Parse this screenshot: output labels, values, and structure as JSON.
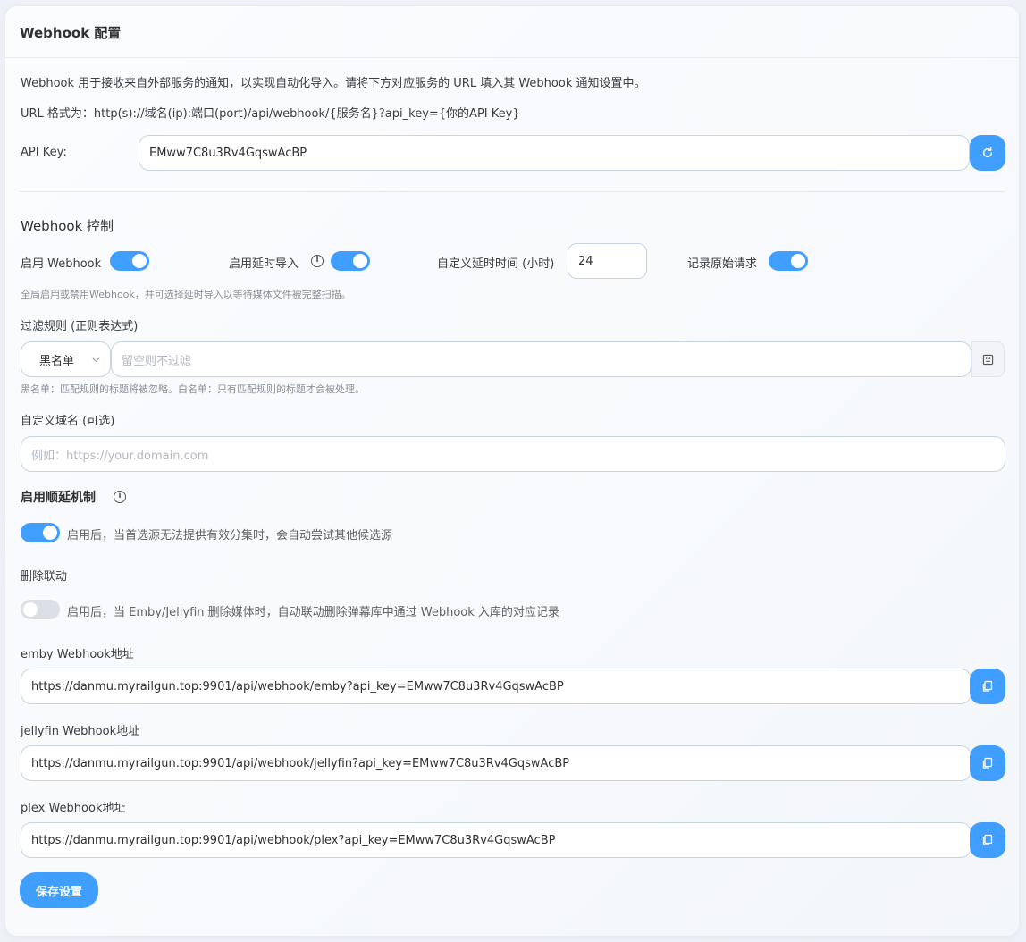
{
  "header": {
    "title": "Webhook 配置"
  },
  "intro": {
    "description": "Webhook 用于接收来自外部服务的通知，以实现自动化导入。请将下方对应服务的 URL 填入其 Webhook 通知设置中。",
    "url_format": "URL 格式为：http(s)://域名(ip):端口(port)/api/webhook/{服务名}?api_key={你的API Key}"
  },
  "api_key": {
    "label": "API Key:",
    "value": "EMww7C8u3Rv4GqswAcBP"
  },
  "control": {
    "title": "Webhook 控制",
    "enable_label": "启用 Webhook",
    "enable_on": true,
    "delay_label": "启用延时导入",
    "delay_on": true,
    "delay_hours_label": "自定义延时时间 (小时)",
    "delay_hours_value": "24",
    "log_raw_label": "记录原始请求",
    "log_raw_on": true,
    "hint": "全局启用或禁用Webhook，并可选择延时导入以等待媒体文件被完整扫描。"
  },
  "filter": {
    "title": "过滤规则 (正则表达式)",
    "mode_value": "黑名单",
    "placeholder": "留空则不过滤",
    "hint": "黑名单：匹配规则的标题将被忽略。白名单：只有匹配规则的标题才会被处理。"
  },
  "domain": {
    "title": "自定义域名 (可选)",
    "placeholder": "例如：https://your.domain.com"
  },
  "fallback": {
    "title": "启用顺延机制",
    "on": true,
    "desc": "启用后，当首选源无法提供有效分集时，会自动尝试其他候选源"
  },
  "delete_link": {
    "title": "删除联动",
    "on": false,
    "desc": "启用后，当 Emby/Jellyfin 删除媒体时，自动联动删除弹幕库中通过 Webhook 入库的对应记录"
  },
  "urls": [
    {
      "label": "emby Webhook地址",
      "value": "https://danmu.myrailgun.top:9901/api/webhook/emby?api_key=EMww7C8u3Rv4GqswAcBP"
    },
    {
      "label": "jellyfin Webhook地址",
      "value": "https://danmu.myrailgun.top:9901/api/webhook/jellyfin?api_key=EMww7C8u3Rv4GqswAcBP"
    },
    {
      "label": "plex Webhook地址",
      "value": "https://danmu.myrailgun.top:9901/api/webhook/plex?api_key=EMww7C8u3Rv4GqswAcBP"
    }
  ],
  "save_label": "保存设置",
  "colors": {
    "accent": "#409eff",
    "toggle_off": "#dcdfe6"
  },
  "icons": [
    "refresh-icon",
    "info-icon",
    "chevron-down-icon",
    "regex-helper-icon",
    "copy-icon"
  ]
}
